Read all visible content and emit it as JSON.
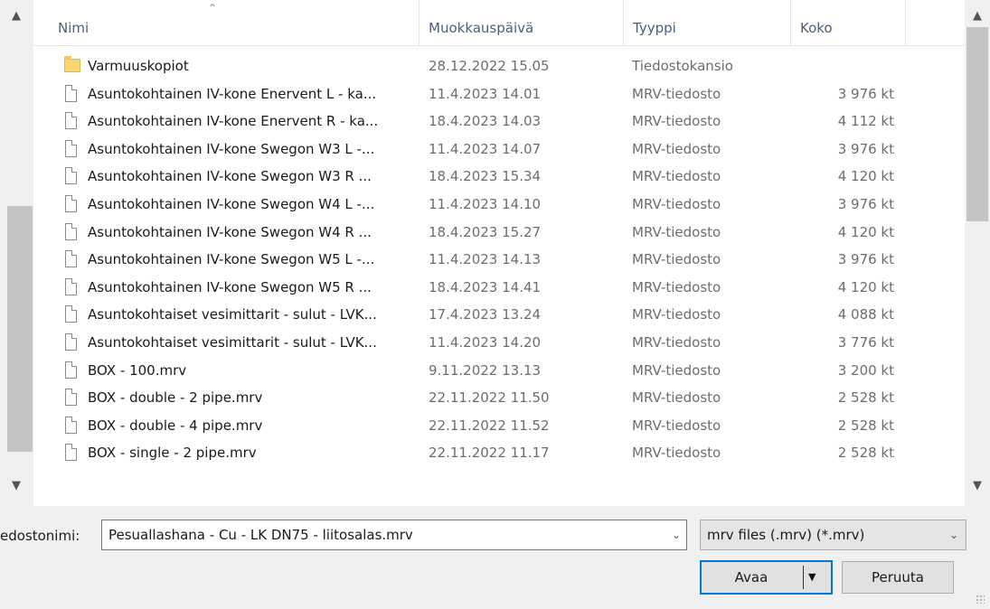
{
  "columns": {
    "name": "Nimi",
    "date": "Muokkauspäivä",
    "type": "Tyyppi",
    "size": "Koko"
  },
  "files": [
    {
      "icon": "folder-icon",
      "name": "Varmuuskopiot",
      "date": "28.12.2022 15.05",
      "type": "Tiedostokansio",
      "size": ""
    },
    {
      "icon": "file-icon",
      "name": "Asuntokohtainen IV-kone Enervent L - ka...",
      "date": "11.4.2023 14.01",
      "type": "MRV-tiedosto",
      "size": "3 976 kt"
    },
    {
      "icon": "file-icon",
      "name": "Asuntokohtainen IV-kone Enervent R - ka...",
      "date": "18.4.2023 14.03",
      "type": "MRV-tiedosto",
      "size": "4 112 kt"
    },
    {
      "icon": "file-icon",
      "name": "Asuntokohtainen IV-kone Swegon W3 L -...",
      "date": "11.4.2023 14.07",
      "type": "MRV-tiedosto",
      "size": "3 976 kt"
    },
    {
      "icon": "file-icon",
      "name": "Asuntokohtainen IV-kone Swegon W3 R ...",
      "date": "18.4.2023 15.34",
      "type": "MRV-tiedosto",
      "size": "4 120 kt"
    },
    {
      "icon": "file-icon",
      "name": "Asuntokohtainen IV-kone Swegon W4 L -...",
      "date": "11.4.2023 14.10",
      "type": "MRV-tiedosto",
      "size": "3 976 kt"
    },
    {
      "icon": "file-icon",
      "name": "Asuntokohtainen IV-kone Swegon W4 R ...",
      "date": "18.4.2023 15.27",
      "type": "MRV-tiedosto",
      "size": "4 120 kt"
    },
    {
      "icon": "file-icon",
      "name": "Asuntokohtainen IV-kone Swegon W5 L -...",
      "date": "11.4.2023 14.13",
      "type": "MRV-tiedosto",
      "size": "3 976 kt"
    },
    {
      "icon": "file-icon",
      "name": "Asuntokohtainen IV-kone Swegon W5 R ...",
      "date": "18.4.2023 14.41",
      "type": "MRV-tiedosto",
      "size": "4 120 kt"
    },
    {
      "icon": "file-icon",
      "name": "Asuntokohtaiset vesimittarit - sulut - LVK...",
      "date": "17.4.2023 13.24",
      "type": "MRV-tiedosto",
      "size": "4 088 kt"
    },
    {
      "icon": "file-icon",
      "name": "Asuntokohtaiset vesimittarit - sulut - LVK...",
      "date": "11.4.2023 14.20",
      "type": "MRV-tiedosto",
      "size": "3 776 kt"
    },
    {
      "icon": "file-icon",
      "name": "BOX - 100.mrv",
      "date": "9.11.2022 13.13",
      "type": "MRV-tiedosto",
      "size": "3 200 kt"
    },
    {
      "icon": "file-icon",
      "name": "BOX - double - 2 pipe.mrv",
      "date": "22.11.2022 11.50",
      "type": "MRV-tiedosto",
      "size": "2 528 kt"
    },
    {
      "icon": "file-icon",
      "name": "BOX - double - 4 pipe.mrv",
      "date": "22.11.2022 11.52",
      "type": "MRV-tiedosto",
      "size": "2 528 kt"
    },
    {
      "icon": "file-icon",
      "name": "BOX - single - 2 pipe.mrv",
      "date": "22.11.2022 11.17",
      "type": "MRV-tiedosto",
      "size": "2 528 kt"
    }
  ],
  "filename": {
    "label": "edostonimi:",
    "value": "Pesuallashana - Cu - LK DN75 - liitosalas.mrv"
  },
  "filetype": {
    "value": "mrv files (.mrv) (*.mrv)"
  },
  "buttons": {
    "open": "Avaa",
    "cancel": "Peruuta"
  }
}
